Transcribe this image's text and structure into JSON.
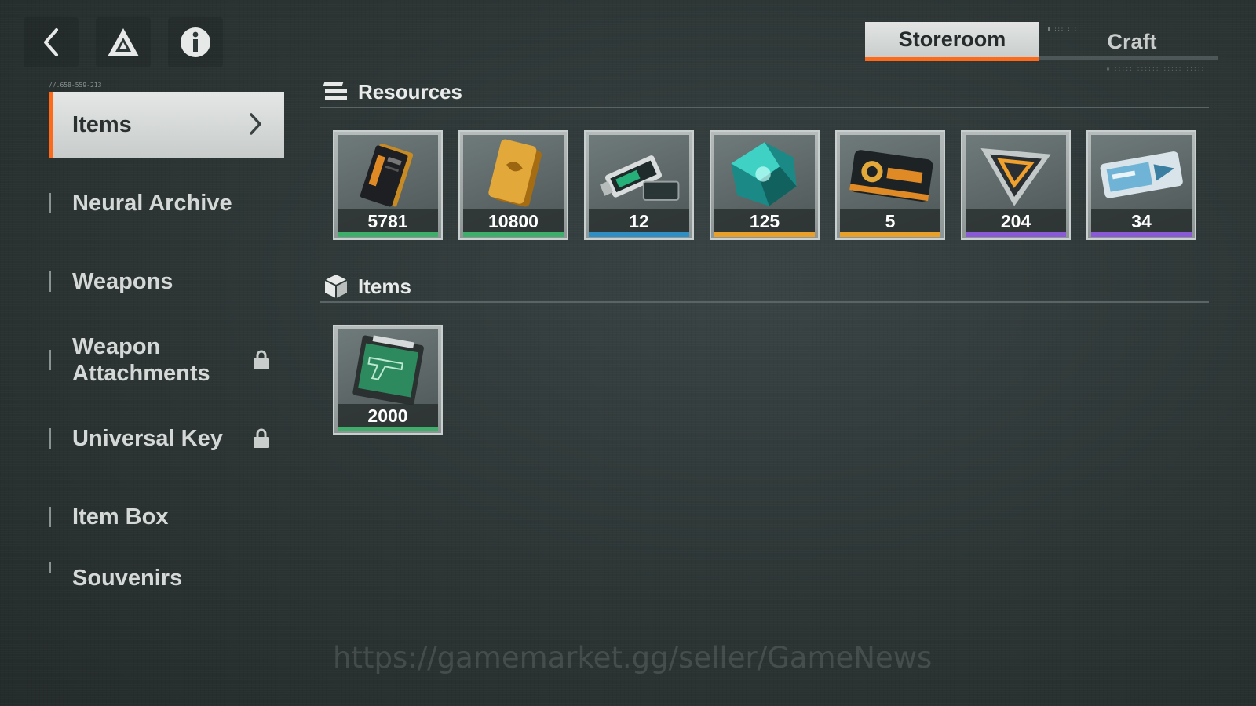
{
  "nav": {
    "back_icon": "chevron-left-icon",
    "logo_icon": "triangle-logo-icon",
    "info_icon": "info-icon"
  },
  "tabs": [
    {
      "label": "Storeroom",
      "active": true
    },
    {
      "label": "Craft",
      "active": false
    }
  ],
  "sidebar": {
    "code": "//.658-559-213",
    "items": [
      {
        "label": "Items",
        "active": true,
        "locked": false
      },
      {
        "label": "Neural Archive",
        "active": false,
        "locked": false
      },
      {
        "label": "Weapons",
        "active": false,
        "locked": false
      },
      {
        "label": "Weapon Attachments",
        "active": false,
        "locked": true
      },
      {
        "label": "Universal Key",
        "active": false,
        "locked": true
      },
      {
        "label": "Item Box",
        "active": false,
        "locked": false
      },
      {
        "label": "Souvenirs",
        "active": false,
        "locked": false
      }
    ]
  },
  "resources": {
    "title": "Resources",
    "icon": "stacked-bars-icon",
    "cards": [
      {
        "count": "5781",
        "rarity_color": "#3fae6a",
        "icon": "black-card-icon"
      },
      {
        "count": "10800",
        "rarity_color": "#3fae6a",
        "icon": "gold-bar-icon"
      },
      {
        "count": "12",
        "rarity_color": "#2f8fc4",
        "icon": "key-chip-icon"
      },
      {
        "count": "125",
        "rarity_color": "#e8a02a",
        "icon": "crystal-icon"
      },
      {
        "count": "5",
        "rarity_color": "#e8a02a",
        "icon": "coin-card-icon"
      },
      {
        "count": "204",
        "rarity_color": "#8a5ad6",
        "icon": "triangle-token-icon"
      },
      {
        "count": "34",
        "rarity_color": "#8a5ad6",
        "icon": "ticket-icon"
      }
    ]
  },
  "items": {
    "title": "Items",
    "icon": "cube-icon",
    "cards": [
      {
        "count": "2000",
        "rarity_color": "#3fae6a",
        "icon": "weapon-blueprint-icon"
      }
    ]
  },
  "watermark": "https://gamemarket.gg/seller/GameNews",
  "colors": {
    "accent": "#ff6a1a",
    "panel": "#2f3838"
  }
}
